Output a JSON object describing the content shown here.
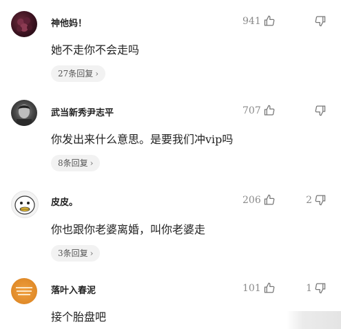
{
  "comments": [
    {
      "username": "神他妈！",
      "text": "她不走你不会走吗",
      "likes": "941",
      "dislikes": "",
      "replies": "27条回复",
      "avatar": "dark-berry-avatar"
    },
    {
      "username": "武当新秀尹志平",
      "text": "你发出来什么意思。是要我们冲vip吗",
      "likes": "707",
      "dislikes": "",
      "replies": "8条回复",
      "avatar": "portrait-avatar"
    },
    {
      "username": "皮皮。",
      "text": "你也跟你老婆离婚，叫你老婆走",
      "likes": "206",
      "dislikes": "2",
      "replies": "3条回复",
      "avatar": "cartoon-face-avatar"
    },
    {
      "username": "落叶入春泥",
      "text": "接个胎盘吧",
      "likes": "101",
      "dislikes": "1",
      "replies": "",
      "avatar": "orange-text-avatar"
    }
  ],
  "icons": {
    "like": "thumbs-up-icon",
    "dislike": "thumbs-down-icon",
    "chevron": "chevron-right-icon"
  }
}
